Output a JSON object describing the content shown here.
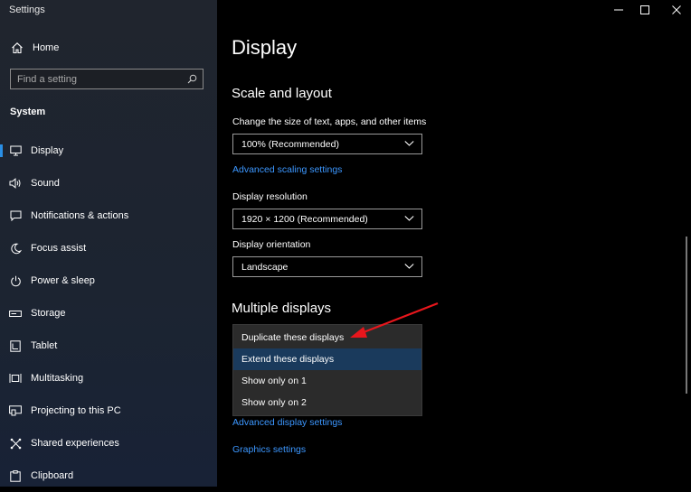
{
  "window": {
    "title": "Settings",
    "controls": {
      "minimize": "—",
      "maximize": "☐",
      "close": "✕"
    }
  },
  "sidebar": {
    "home_label": "Home",
    "search_placeholder": "Find a setting",
    "section_label": "System",
    "items": [
      {
        "label": "Display",
        "icon": "monitor-icon",
        "selected": true
      },
      {
        "label": "Sound",
        "icon": "speaker-icon"
      },
      {
        "label": "Notifications & actions",
        "icon": "notification-icon"
      },
      {
        "label": "Focus assist",
        "icon": "moon-icon"
      },
      {
        "label": "Power & sleep",
        "icon": "power-icon"
      },
      {
        "label": "Storage",
        "icon": "storage-icon"
      },
      {
        "label": "Tablet",
        "icon": "tablet-icon"
      },
      {
        "label": "Multitasking",
        "icon": "multitasking-icon"
      },
      {
        "label": "Projecting to this PC",
        "icon": "projector-icon"
      },
      {
        "label": "Shared experiences",
        "icon": "shared-icon"
      },
      {
        "label": "Clipboard",
        "icon": "clipboard-icon"
      }
    ]
  },
  "main": {
    "page_title": "Display",
    "scale_heading": "Scale and layout",
    "scale_label": "Change the size of text, apps, and other items",
    "scale_value": "100% (Recommended)",
    "advanced_scaling_link": "Advanced scaling settings",
    "resolution_label": "Display resolution",
    "resolution_value": "1920 × 1200 (Recommended)",
    "orientation_label": "Display orientation",
    "orientation_value": "Landscape",
    "multiple_heading": "Multiple displays",
    "multiple_options": [
      "Duplicate these displays",
      "Extend these displays",
      "Show only on 1",
      "Show only on 2"
    ],
    "highlighted_option": "Extend these displays",
    "advanced_display_link": "Advanced display settings",
    "graphics_link": "Graphics settings"
  },
  "colors": {
    "accent": "#2a8fe6",
    "link": "#3c97ff",
    "annotation_arrow": "#e8161c",
    "menu_highlight": "#1a3a5c"
  }
}
